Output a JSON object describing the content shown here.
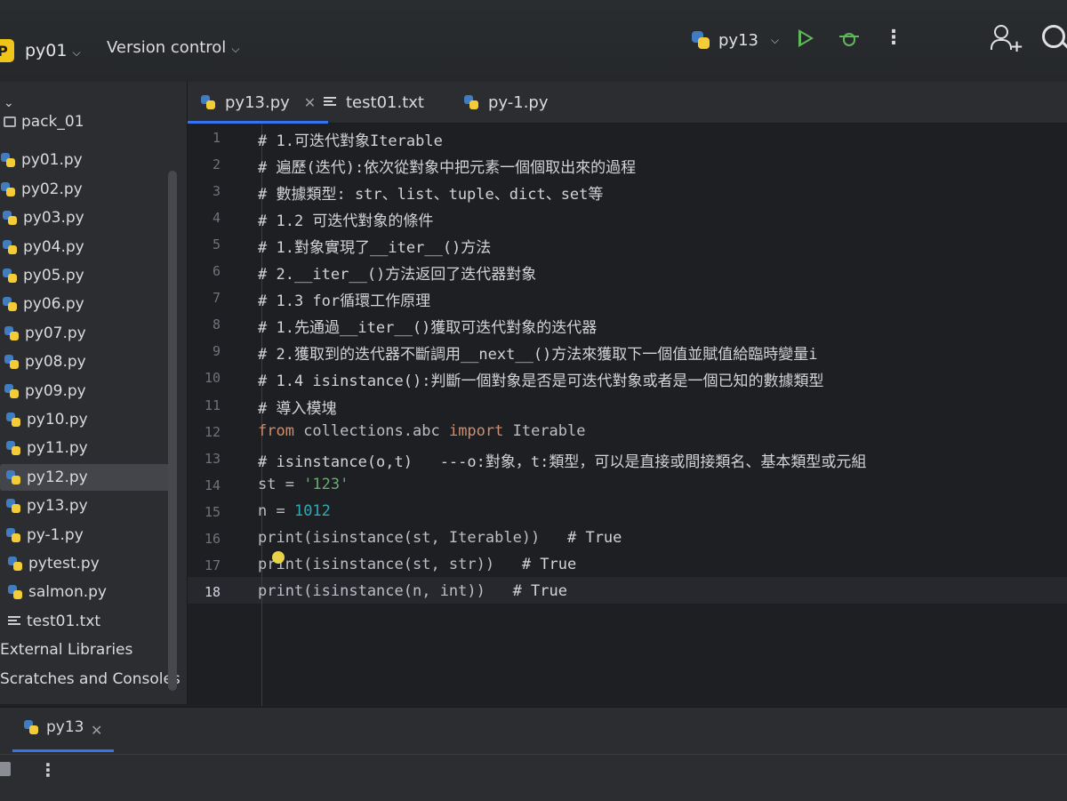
{
  "toolbar": {
    "project_badge": "P",
    "project_name": "py01",
    "vcs_label": "Version control",
    "run_config": "py13"
  },
  "sidebar": {
    "items": [
      {
        "label": "pack_01",
        "kind": "folder"
      },
      {
        "label": "py01.py",
        "kind": "python"
      },
      {
        "label": "py02.py",
        "kind": "python"
      },
      {
        "label": "py03.py",
        "kind": "python"
      },
      {
        "label": "py04.py",
        "kind": "python"
      },
      {
        "label": "py05.py",
        "kind": "python"
      },
      {
        "label": "py06.py",
        "kind": "python"
      },
      {
        "label": "py07.py",
        "kind": "python"
      },
      {
        "label": "py08.py",
        "kind": "python"
      },
      {
        "label": "py09.py",
        "kind": "python"
      },
      {
        "label": "py10.py",
        "kind": "python"
      },
      {
        "label": "py11.py",
        "kind": "python"
      },
      {
        "label": "py12.py",
        "kind": "python",
        "selected": true
      },
      {
        "label": "py13.py",
        "kind": "python"
      },
      {
        "label": "py-1.py",
        "kind": "python"
      },
      {
        "label": "pytest.py",
        "kind": "python"
      },
      {
        "label": "salmon.py",
        "kind": "python"
      },
      {
        "label": "test01.txt",
        "kind": "text"
      },
      {
        "label": "External Libraries",
        "kind": "library"
      },
      {
        "label": "Scratches and Consoles",
        "kind": "scratch"
      }
    ]
  },
  "tabs": [
    {
      "label": "py13.py",
      "icon": "python-icon",
      "active": true
    },
    {
      "label": "test01.txt",
      "icon": "text-file-icon",
      "active": false
    },
    {
      "label": "py-1.py",
      "icon": "python-icon",
      "active": false
    }
  ],
  "editor": {
    "current_line": 18,
    "lines": [
      {
        "n": "1",
        "text": "# 1.可迭代對象Iterable"
      },
      {
        "n": "2",
        "text": "# 遍歷(迭代):依次從對象中把元素一個個取出來的過程"
      },
      {
        "n": "3",
        "text": "# 數據類型: str、list、tuple、dict、set等"
      },
      {
        "n": "4",
        "text": "# 1.2 可迭代對象的條件"
      },
      {
        "n": "5",
        "text": "# 1.對象實現了__iter__()方法"
      },
      {
        "n": "6",
        "text": "# 2.__iter__()方法返回了迭代器對象"
      },
      {
        "n": "7",
        "text": "# 1.3 for循環工作原理"
      },
      {
        "n": "8",
        "text": "# 1.先通過__iter__()獲取可迭代對象的迭代器"
      },
      {
        "n": "9",
        "text": "# 2.獲取到的迭代器不斷調用__next__()方法來獲取下一個值並賦值給臨時變量i"
      },
      {
        "n": "10",
        "text": "# 1.4 isinstance():判斷一個對象是否是可迭代對象或者是一個已知的數據類型"
      },
      {
        "n": "11",
        "text": "# 導入模塊"
      },
      {
        "n": "12",
        "parts": [
          "from",
          " collections.abc ",
          "import",
          " Iterable"
        ]
      },
      {
        "n": "13",
        "text": "# isinstance(o,t)   ---o:對象，t:類型，可以是直接或間接類名、基本類型或元組"
      },
      {
        "n": "14",
        "parts": [
          "st = ",
          "'123'"
        ]
      },
      {
        "n": "15",
        "parts": [
          "n = ",
          "1012"
        ]
      },
      {
        "n": "16",
        "parts": [
          "print(isinstance(st, Iterable))",
          "   # True"
        ]
      },
      {
        "n": "17",
        "parts": [
          "print(isinstance(st, str))",
          "   # True"
        ]
      },
      {
        "n": "18",
        "parts": [
          "print(isinstance(n, int))",
          "   # True"
        ]
      }
    ]
  },
  "bottom_panel": {
    "tab_label": "py13"
  },
  "colors": {
    "accent": "#3574f0",
    "keyword": "#cf8e6d",
    "string": "#6aab73",
    "number": "#2aacb8",
    "run_green": "#5fb85a",
    "project_badge": "#f0c419"
  }
}
